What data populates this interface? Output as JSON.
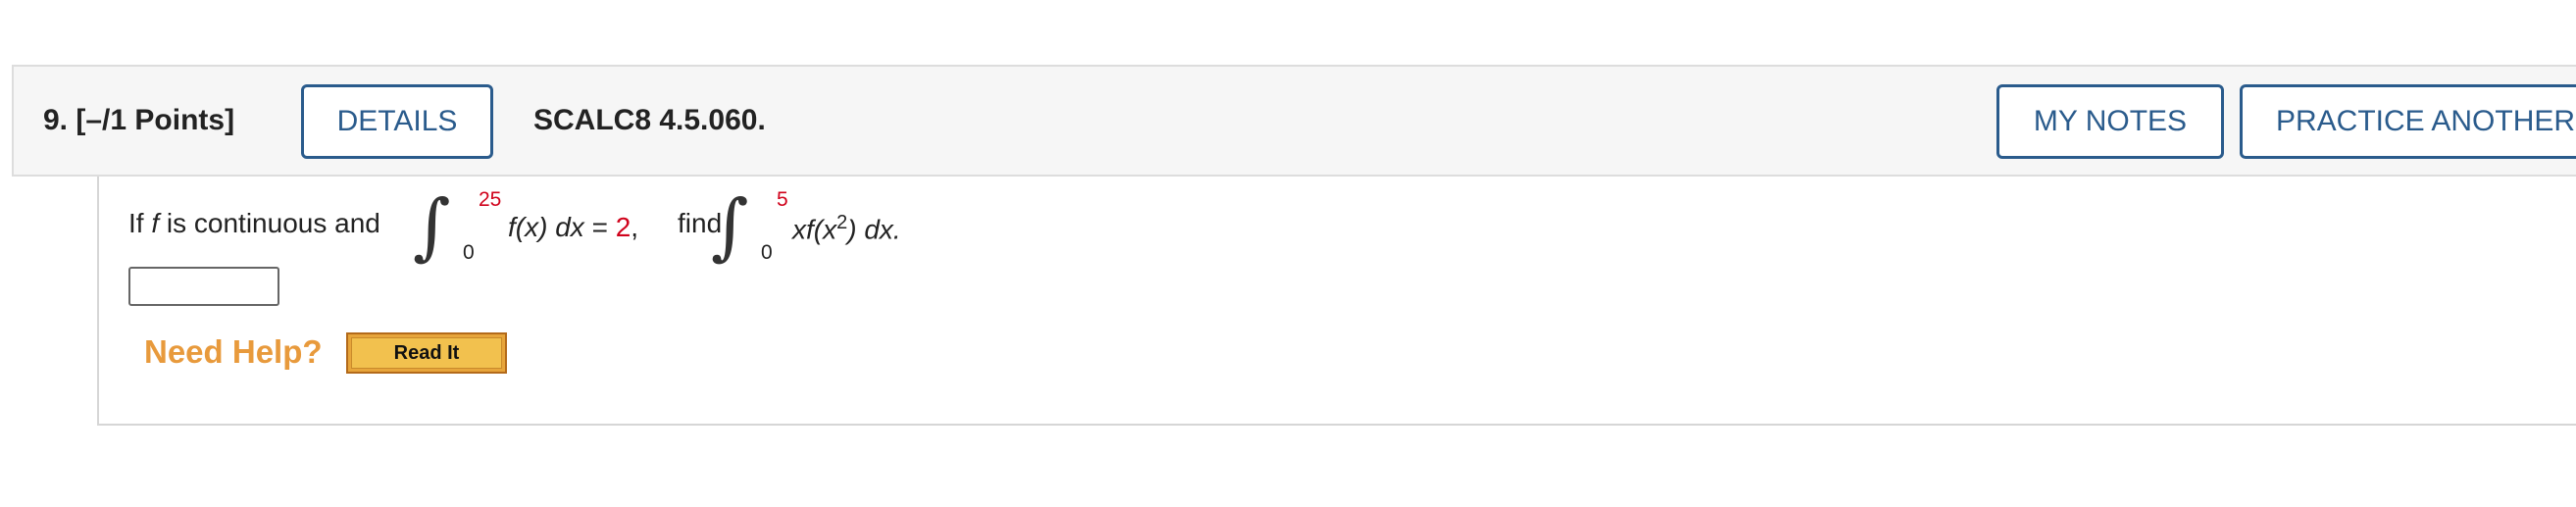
{
  "question": {
    "number_label": "9.",
    "points_label": "[–/1 Points]",
    "details_button": "DETAILS",
    "code": "SCALC8 4.5.060.",
    "my_notes_button": "MY NOTES",
    "practice_button": "PRACTICE ANOTHER"
  },
  "problem": {
    "prefix": "If",
    "f_var": "f",
    "is_continuous": "is continuous and",
    "int1": {
      "upper": "25",
      "lower": "0",
      "integrand": "f(x) dx",
      "equals": "=",
      "value": "2",
      "comma": ","
    },
    "find": "find",
    "int2": {
      "upper": "5",
      "lower": "0",
      "integrand_main": "xf(x",
      "integrand_sup": "2",
      "integrand_tail": ") dx."
    }
  },
  "answer": {
    "value": ""
  },
  "help": {
    "label": "Need Help?",
    "read_it": "Read It"
  },
  "colors": {
    "accent_blue": "#2a5b8c",
    "highlight_red": "#d0021b",
    "help_orange": "#e89a3c",
    "read_it_fill": "#f2c14e"
  }
}
